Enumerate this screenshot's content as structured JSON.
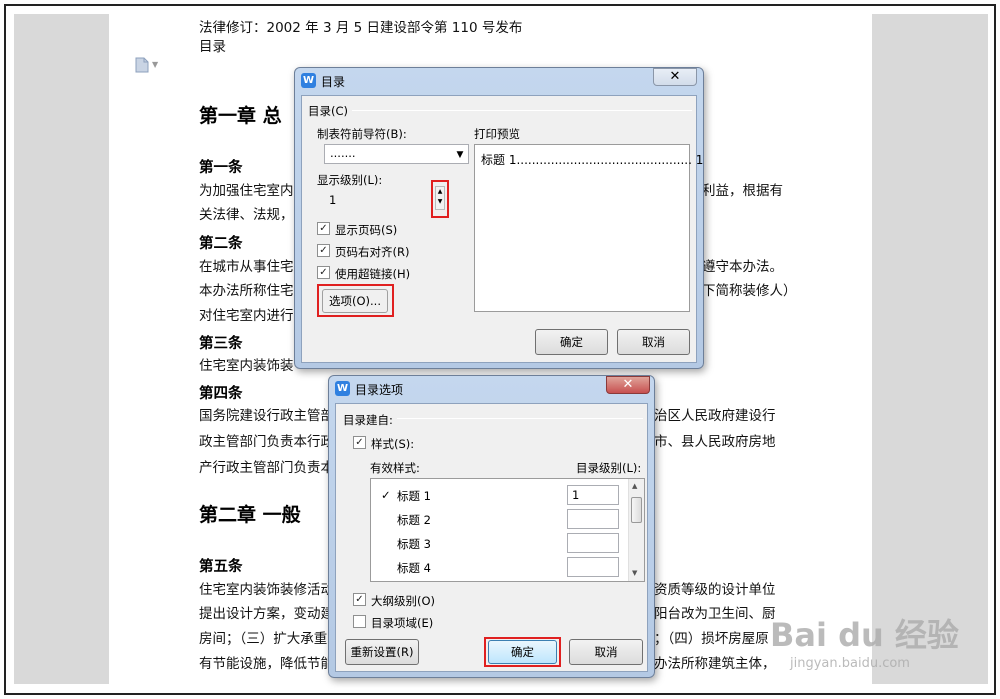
{
  "document": {
    "line1": "法律修订：2002 年 3 月 5 日建设部令第 110 号发布",
    "line2": "目录",
    "chapter1": "第一章  总",
    "art1_title": "第一条",
    "art1_l1a": "为加强住宅室内",
    "art1_l1b": "利益，根据有",
    "art1_l2": "关法律、法规，",
    "art2_title": "第二条",
    "art2_l1a": "在城市从事住宅",
    "art2_l1b": "遵守本办法。",
    "art2_l2a": "本办法所称住宅",
    "art2_l2b": "下简称装修人）",
    "art2_l3": "对住宅室内进行",
    "art3_title": "第三条",
    "art3_l1": "住宅室内装饰装",
    "art4_title": "第四条",
    "art4_l1a": "国务院建设行政主管部",
    "art4_l1b": "治区人民政府建设行",
    "art4_l2a": "政主管部门负责本行政",
    "art4_l2b": "市、县人民政府房地",
    "art4_l3": "产行政主管部门负责本",
    "chapter2": "第二章  一般",
    "art5_title": "第五条",
    "art5_l1a": "住宅室内装饰装修活动",
    "art5_l1b": "资质等级的设计单位",
    "art5_l2a": "提出设计方案，变动建",
    "art5_l2b": "阳台改为卫生间、厨",
    "art5_l3a": "房间；（三）扩大承重",
    "art5_l3b": "；（四）损坏房屋原",
    "art5_l4a": "有节能设施，降低节能",
    "art5_l4b": "办法所称建筑主体，"
  },
  "toc_dialog": {
    "title": "目录",
    "close": "✕",
    "group_label": "目录(C)",
    "leader_label": "制表符前导符(B):",
    "leader_value": ".......",
    "levels_label": "显示级别(L):",
    "levels_value": "1",
    "show_page_numbers": "显示页码(S)",
    "right_align": "页码右对齐(R)",
    "use_hyperlinks": "使用超链接(H)",
    "options_button": "选项(O)...",
    "preview_label": "打印预览",
    "preview_text": "标题  1.............................................. 1",
    "ok": "确定",
    "cancel": "取消"
  },
  "options_dialog": {
    "title": "目录选项",
    "close": "✕",
    "build_from": "目录建自:",
    "styles_label": "样式(S):",
    "available_styles": "有效样式:",
    "toc_level": "目录级别(L):",
    "rows": [
      {
        "checked": "✓",
        "name": "标题 1",
        "level": "1"
      },
      {
        "checked": "",
        "name": "标题 2",
        "level": ""
      },
      {
        "checked": "",
        "name": "标题 3",
        "level": ""
      },
      {
        "checked": "",
        "name": "标题 4",
        "level": ""
      }
    ],
    "outline_levels": "大纲级别(O)",
    "toc_fields": "目录项域(E)",
    "reset": "重新设置(R)",
    "ok": "确定",
    "cancel": "取消"
  },
  "watermark": {
    "brand": "Bai du 经验",
    "url": "jingyan.baidu.com"
  },
  "colors": {
    "highlight_red": "#e02020",
    "title_bar": "#c4d7ee",
    "close_red": "#c75050"
  }
}
